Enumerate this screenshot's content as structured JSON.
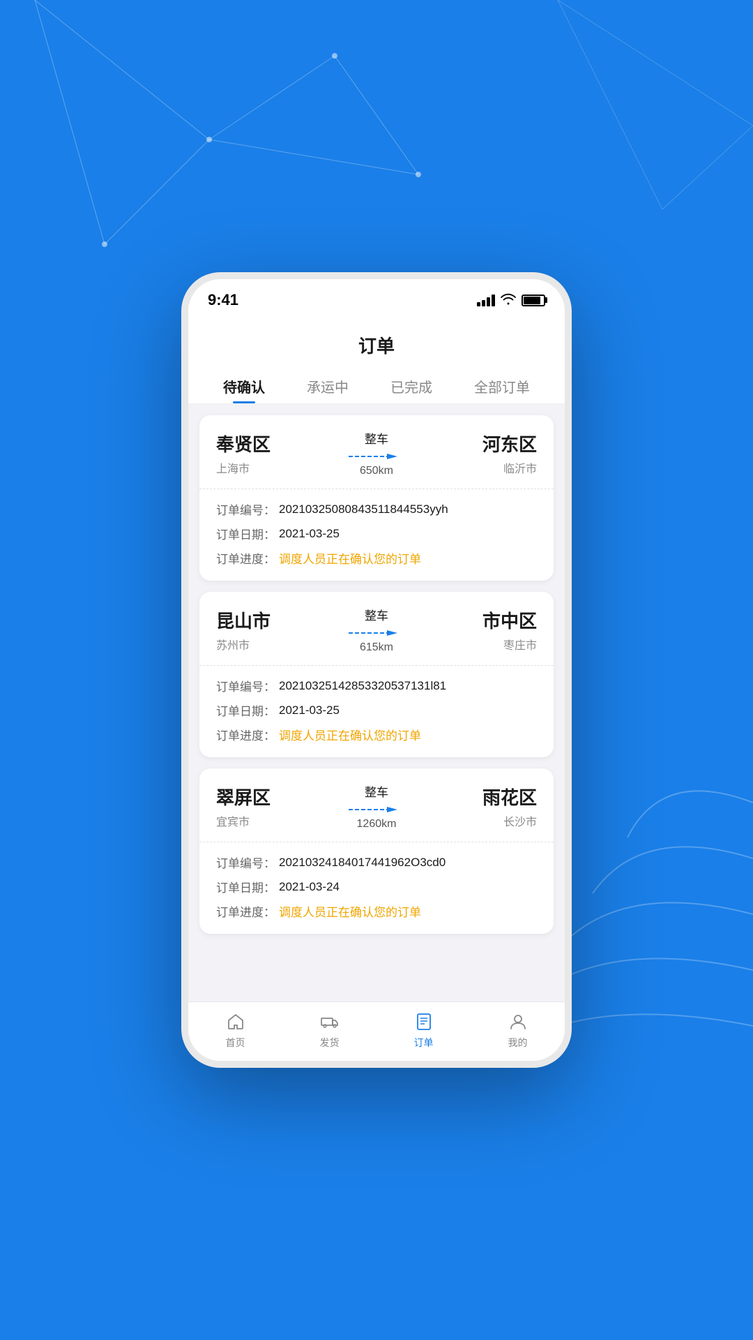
{
  "background": {
    "color": "#1a7fe8"
  },
  "status_bar": {
    "time": "9:41"
  },
  "page_header": {
    "title": "订单"
  },
  "tabs": [
    {
      "id": "pending",
      "label": "待确认",
      "active": true
    },
    {
      "id": "in_transit",
      "label": "承运中",
      "active": false
    },
    {
      "id": "completed",
      "label": "已完成",
      "active": false
    },
    {
      "id": "all",
      "label": "全部订单",
      "active": false
    }
  ],
  "orders": [
    {
      "from_city": "奉贤区",
      "from_province": "上海市",
      "to_city": "河东区",
      "to_province": "临沂市",
      "type": "整车",
      "distance": "650km",
      "order_no_label": "订单编号：",
      "order_no": "20210325080843511844553yyh",
      "order_date_label": "订单日期：",
      "order_date": "2021-03-25",
      "order_progress_label": "订单进度：",
      "order_progress": "调度人员正在确认您的订单"
    },
    {
      "from_city": "昆山市",
      "from_province": "苏州市",
      "to_city": "市中区",
      "to_province": "枣庄市",
      "type": "整车",
      "distance": "615km",
      "order_no_label": "订单编号：",
      "order_no": "20210325142853320537131l81",
      "order_date_label": "订单日期：",
      "order_date": "2021-03-25",
      "order_progress_label": "订单进度：",
      "order_progress": "调度人员正在确认您的订单"
    },
    {
      "from_city": "翠屏区",
      "from_province": "宜宾市",
      "to_city": "雨花区",
      "to_province": "长沙市",
      "type": "整车",
      "distance": "1260km",
      "order_no_label": "订单编号：",
      "order_no": "20210324184017441962O3cd0",
      "order_date_label": "订单日期：",
      "order_date": "2021-03-24",
      "order_progress_label": "订单进度：",
      "order_progress": "调度人员正在确认您的订单"
    }
  ],
  "bottom_nav": [
    {
      "id": "home",
      "label": "首页",
      "active": false
    },
    {
      "id": "ship",
      "label": "发货",
      "active": false
    },
    {
      "id": "orders",
      "label": "订单",
      "active": true
    },
    {
      "id": "profile",
      "label": "我的",
      "active": false
    }
  ]
}
